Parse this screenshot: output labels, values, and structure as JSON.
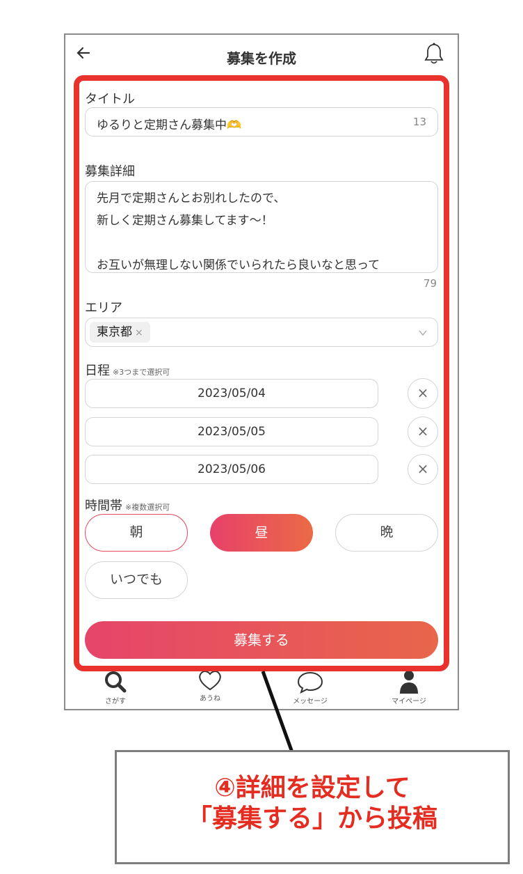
{
  "header": {
    "title": "募集を作成",
    "back_icon": "arrow-left-icon",
    "notification_icon": "bell-icon"
  },
  "form": {
    "title_label": "タイトル",
    "title_value": "ゆるりと定期さん募集中🫶",
    "title_count": "13",
    "detail_label": "募集詳細",
    "detail_value": "先月で定期さんとお別れしたので、\n新しく定期さん募集してます〜！\n\nお互いが無理しない関係でいられたら良いなと思って",
    "detail_count": "79",
    "area_label": "エリア",
    "area_selected": "東京都",
    "area_chip_remove": "×",
    "schedule_label": "日程",
    "schedule_note": "※3つまで選択可",
    "dates": [
      "2023/05/04",
      "2023/05/05",
      "2023/05/06"
    ],
    "date_clear_symbol": "×",
    "time_label": "時間帯",
    "time_note": "※複数選択可",
    "time_options": [
      "朝",
      "昼",
      "晩",
      "いつでも"
    ],
    "submit_label": "募集する"
  },
  "tabbar": {
    "items": [
      {
        "label": "さがす",
        "icon": "search-icon"
      },
      {
        "label": "あうね",
        "icon": "heart-icon"
      },
      {
        "label": "メッセージ",
        "icon": "chat-icon"
      },
      {
        "label": "マイページ",
        "icon": "user-icon"
      }
    ]
  },
  "annotation": {
    "text": "④詳細を設定して\n「募集する」から投稿",
    "highlight_color": "#e8322b",
    "text_color": "#e42c20"
  },
  "colors": {
    "accent_start": "#e8416a",
    "accent_end": "#ea6a45"
  }
}
